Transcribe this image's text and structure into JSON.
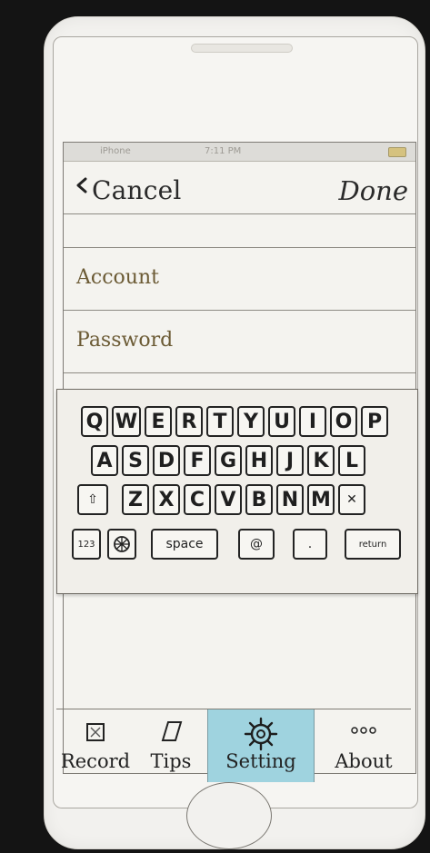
{
  "status_bar": {
    "carrier": "iPhone",
    "time": "7:11 PM"
  },
  "navigation": {
    "cancel_label": "Cancel",
    "done_label": "Done"
  },
  "form": {
    "account_label": "Account",
    "password_label": "Password"
  },
  "keyboard": {
    "row1": [
      "Q",
      "W",
      "E",
      "R",
      "T",
      "Y",
      "U",
      "I",
      "O",
      "P"
    ],
    "row2": [
      "A",
      "S",
      "D",
      "F",
      "G",
      "H",
      "J",
      "K",
      "L"
    ],
    "row3": [
      "Z",
      "X",
      "C",
      "V",
      "B",
      "N",
      "M"
    ],
    "shift_label": "⇧",
    "delete_label": "✕",
    "numbers_label": "123",
    "space_label": "space",
    "at_label": "@",
    "dot_label": ".",
    "return_label": "return"
  },
  "tabbar": {
    "items": [
      {
        "label": "Record",
        "icon": "record-icon"
      },
      {
        "label": "Tips",
        "icon": "tips-icon"
      },
      {
        "label": "Setting",
        "icon": "gear-icon"
      },
      {
        "label": "About",
        "icon": "more-icon"
      }
    ],
    "active_index": 2
  },
  "colors": {
    "active_tab": "#9fd3df",
    "battery": "#d5c27f"
  }
}
